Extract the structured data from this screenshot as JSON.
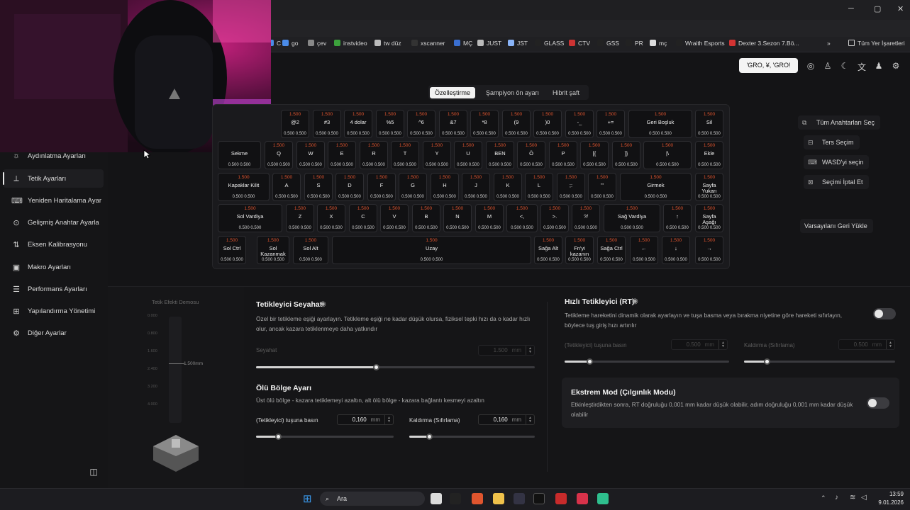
{
  "window": {
    "min": "─",
    "max": "▢",
    "close": "✕"
  },
  "bookmarks": [
    {
      "label": "C",
      "color": "#4a8be8"
    },
    {
      "label": "go",
      "color": "#4a8be8"
    },
    {
      "label": "çev",
      "color": "#888888"
    },
    {
      "label": "instvideo",
      "color": "#3ca13c"
    },
    {
      "label": "tw düz",
      "color": "#bbbbbb"
    },
    {
      "label": "xscanner",
      "color": "#333333"
    },
    {
      "label": "MÇ",
      "color": "#3a6fd0"
    },
    {
      "label": "JUST",
      "color": "#bbbbbb"
    },
    {
      "label": "JST",
      "color": "#8ab4f8"
    },
    {
      "label": "GLASS",
      "color": "#222222"
    },
    {
      "label": "CTV",
      "color": "#cc3333"
    },
    {
      "label": "GSS",
      "color": "#222222"
    },
    {
      "label": "PR",
      "color": "#222222"
    },
    {
      "label": "mç",
      "color": "#dddddd"
    },
    {
      "label": "Wraith Esports",
      "color": "#222222"
    },
    {
      "label": "Dexter 3.Sezon 7.Bö...",
      "color": "#d33333"
    }
  ],
  "bookmarks_more": "»",
  "all_bookmarks": "Tüm Yer İşaretleri",
  "header": {
    "profile_button": "'GRO, ¥, 'GRO!"
  },
  "sidebar": {
    "items": [
      {
        "label": "Aydınlatma Ayarları",
        "icon": "bulb-icon",
        "glyph": "☼"
      },
      {
        "label": "Tetik Ayarları",
        "icon": "trigger-icon",
        "glyph": "⟂"
      },
      {
        "label": "Yeniden Haritalama Ayar",
        "icon": "remap-icon",
        "glyph": "⌨"
      },
      {
        "label": "Gelişmiş Anahtar Ayarla",
        "icon": "advanced-key-icon",
        "glyph": "⊙"
      },
      {
        "label": "Eksen Kalibrasyonu",
        "icon": "axis-icon",
        "glyph": "⇅"
      },
      {
        "label": "Makro Ayarları",
        "icon": "macro-icon",
        "glyph": "▣"
      },
      {
        "label": "Performans Ayarları",
        "icon": "performance-icon",
        "glyph": "☰"
      },
      {
        "label": "Yapılandırma Yönetimi",
        "icon": "config-icon",
        "glyph": "⊞"
      },
      {
        "label": "Diğer Ayarlar",
        "icon": "other-settings-icon",
        "glyph": "⚙"
      }
    ],
    "collapse": "◫"
  },
  "tabs": [
    "Özelleştirme",
    "Şampiyon ön ayarı",
    "Hibrit şaft"
  ],
  "keyboard": {
    "rows": [
      [
        {
          "l": "@2",
          "t": "1.500",
          "b": "0.500 0.500"
        },
        {
          "l": "#3",
          "t": "1.500",
          "b": "0.500 0.500"
        },
        {
          "l": "4 dolar",
          "t": "1.500",
          "b": "0.500 0.500"
        },
        {
          "l": "%5",
          "t": "1.500",
          "b": "0.500 0.500"
        },
        {
          "l": "^6",
          "t": "1.500",
          "b": "0.500 0.500"
        },
        {
          "l": "&7",
          "t": "1.500",
          "b": "0.500 0.500"
        },
        {
          "l": "*8",
          "t": "1.500",
          "b": "0.500 0.500"
        },
        {
          "l": "(9",
          "t": "1.500",
          "b": "0.500 0.500"
        },
        {
          "l": ")0",
          "t": "1.500",
          "b": "0.500 0.500"
        },
        {
          "l": "-_",
          "t": "1.500",
          "b": "0.500 0.500"
        },
        {
          "l": "+=",
          "t": "1.500",
          "b": "0.500 0.500"
        },
        {
          "l": "Geri Boşluk",
          "t": "1.500",
          "b": "0.500 0.500"
        },
        {
          "l": "Sil",
          "t": "1.500",
          "b": "0.500 0.500"
        }
      ],
      [
        {
          "l": "Sekme",
          "t": "",
          "b": "0.500 0.500"
        },
        {
          "l": "Q",
          "t": "1.500",
          "b": "0.500 0.500"
        },
        {
          "l": "W",
          "t": "1.500",
          "b": "0.500 0.500"
        },
        {
          "l": "E",
          "t": "1.500",
          "b": "0.500 0.500"
        },
        {
          "l": "R",
          "t": "1.500",
          "b": "0.500 0.500"
        },
        {
          "l": "T",
          "t": "1.500",
          "b": "0.500 0.500"
        },
        {
          "l": "Y",
          "t": "1.500",
          "b": "0.500 0.500"
        },
        {
          "l": "U",
          "t": "1.500",
          "b": "0.500 0.500"
        },
        {
          "l": "BEN",
          "t": "1.500",
          "b": "0.500 0.500"
        },
        {
          "l": "Ö",
          "t": "1.500",
          "b": "0.500 0.500"
        },
        {
          "l": "P",
          "t": "1.500",
          "b": "0.500 0.500"
        },
        {
          "l": "[{",
          "t": "1.500",
          "b": "0.500 0.500"
        },
        {
          "l": "]}",
          "t": "1.500",
          "b": "0.500 0.500"
        },
        {
          "l": "|\\",
          "t": "1.500",
          "b": "0.500 0.500"
        },
        {
          "l": "Ekle",
          "t": "1.500",
          "b": "0.500 0.500"
        }
      ],
      [
        {
          "l": "Kapaklar Kilit",
          "t": "1.500",
          "b": "0.500 0.500"
        },
        {
          "l": "A",
          "t": "1.500",
          "b": "0.500 0.500"
        },
        {
          "l": "S",
          "t": "1.500",
          "b": "0.500 0.500"
        },
        {
          "l": "D",
          "t": "1.500",
          "b": "0.500 0.500"
        },
        {
          "l": "F",
          "t": "1.500",
          "b": "0.500 0.500"
        },
        {
          "l": "G",
          "t": "1.500",
          "b": "0.500 0.500"
        },
        {
          "l": "H",
          "t": "1.500",
          "b": "0.500 0.500"
        },
        {
          "l": "J",
          "t": "1.500",
          "b": "0.500 0.500"
        },
        {
          "l": "K",
          "t": "1.500",
          "b": "0.500 0.500"
        },
        {
          "l": "L",
          "t": "1.500",
          "b": "0.500 0.500"
        },
        {
          "l": ";:",
          "t": "1.500",
          "b": "0.500 0.500"
        },
        {
          "l": "'\"",
          "t": "1.500",
          "b": "0.500 0.500"
        },
        {
          "l": "Girmek",
          "t": "1.500",
          "b": "0.500 0.500"
        },
        {
          "l": "Sayfa Yukarı",
          "t": "1.500",
          "b": "0.500 0.500"
        }
      ],
      [
        {
          "l": "Sol Vardiya",
          "t": "1.500",
          "b": "0.500 0.500"
        },
        {
          "l": "Z",
          "t": "1.500",
          "b": "0.500 0.500"
        },
        {
          "l": "X",
          "t": "1.500",
          "b": "0.500 0.500"
        },
        {
          "l": "C",
          "t": "1.500",
          "b": "0.500 0.500"
        },
        {
          "l": "V",
          "t": "1.500",
          "b": "0.500 0.500"
        },
        {
          "l": "B",
          "t": "1.500",
          "b": "0.500 0.500"
        },
        {
          "l": "N",
          "t": "1.500",
          "b": "0.500 0.500"
        },
        {
          "l": "M",
          "t": "1.500",
          "b": "0.500 0.500"
        },
        {
          "l": "<,",
          "t": "1.500",
          "b": "0.500 0.500"
        },
        {
          "l": ">.",
          "t": "1.500",
          "b": "0.500 0.500"
        },
        {
          "l": "?/",
          "t": "1.500",
          "b": "0.500 0.500"
        },
        {
          "l": "Sağ Vardiya",
          "t": "1.500",
          "b": "0.500 0.500"
        },
        {
          "l": "↑",
          "t": "1.500",
          "b": "0.500 0.500"
        },
        {
          "l": "Sayfa Aşağı",
          "t": "1.500",
          "b": "0.500 0.500"
        }
      ],
      [
        {
          "l": "Sol Ctrl",
          "t": "1.500",
          "b": "0.500 0.500"
        },
        {
          "l": "Sol Kazanmak",
          "t": "1.500",
          "b": "0.500 0.500"
        },
        {
          "l": "Sol Alt",
          "t": "1.500",
          "b": "0.500 0.500"
        },
        {
          "l": "Uzay",
          "t": "1.500",
          "b": "0.500 0.500"
        },
        {
          "l": "Sağa Alt",
          "t": "1.500",
          "b": "0.500 0.500"
        },
        {
          "l": "Fn'yi kazanın",
          "t": "1.500",
          "b": "0.500 0.500"
        },
        {
          "l": "Sağa Ctrl",
          "t": "1.500",
          "b": "0.500 0.500"
        },
        {
          "l": "←",
          "t": "1.500",
          "b": "0.500 0.500"
        },
        {
          "l": "↓",
          "t": "1.500",
          "b": "0.500 0.500"
        },
        {
          "l": "→",
          "t": "1.500",
          "b": "0.500 0.500"
        }
      ]
    ]
  },
  "right_actions": [
    {
      "label": "Tüm Anahtarları Seç",
      "icon": "select-all-icon",
      "glyph": "⧉"
    },
    {
      "label": "Ters Seçim",
      "icon": "invert-icon",
      "glyph": "⊟"
    },
    {
      "label": "WASD'yi seçin",
      "icon": "wasd-icon",
      "glyph": "⌨"
    },
    {
      "label": "Seçimi İptal Et",
      "icon": "cancel-selection-icon",
      "glyph": "⊠"
    },
    {
      "label": "Varsayılanı Geri Yükle",
      "icon": "",
      "glyph": ""
    }
  ],
  "demo": {
    "title": "Tetik Efekti Demosu",
    "ticks": [
      "0.000",
      "0.800",
      "1.600",
      "2.400",
      "3.200",
      "4.000"
    ],
    "marker": "1.500mm"
  },
  "trigger_travel": {
    "title": "Tetikleyici Seyahat",
    "desc": "Özel bir tetikleme eşiği ayarlayın. Tetikleme eşiği ne kadar düşük olursa, fiziksel tepki hızı da o kadar hızlı olur, ancak kazara tetiklenmeye daha yatkındır",
    "travel_label": "Seyahat",
    "travel_value": "1.500",
    "unit": "mm",
    "travel_fraction": 0.43
  },
  "deadzone": {
    "title": "Ölü Bölge Ayarı",
    "desc": "Üst ölü bölge - kazara tetiklemeyi azaltın, alt ölü bölge - kazara bağlantı kesmeyi azaltın",
    "press_label": "(Tetikleyici) tuşuna basın",
    "press_value": "0,160",
    "release_label": "Kaldırma (Sıfırlama)",
    "release_value": "0,160",
    "unit": "mm",
    "press_fraction": 0.16,
    "release_fraction": 0.16
  },
  "rapid": {
    "title": "Hızlı Tetikleyici (RT)",
    "desc": "Tetikleme hareketini dinamik olarak ayarlayın ve tuşa basma veya bırakma niyetine göre hareketi sıfırlayın, böylece tuş giriş hızı artırılır",
    "press_label": "(Tetikleyici) tuşuna basın",
    "press_value": "0.500",
    "release_label": "Kaldırma (Sıfırlama)",
    "release_value": "0.500",
    "unit": "mm",
    "press_fraction": 0.15,
    "release_fraction": 0.15
  },
  "extreme": {
    "title": "Ekstrem Mod (Çılgınlık Modu)",
    "desc": "Etkinleştirdikten sonra, RT doğruluğu 0,001 mm kadar düşük olabilir, adım doğruluğu 0,001 mm kadar düşük olabilir"
  },
  "taskbar": {
    "search": "Ara",
    "time": "13:59",
    "date": "9.01.2026"
  }
}
